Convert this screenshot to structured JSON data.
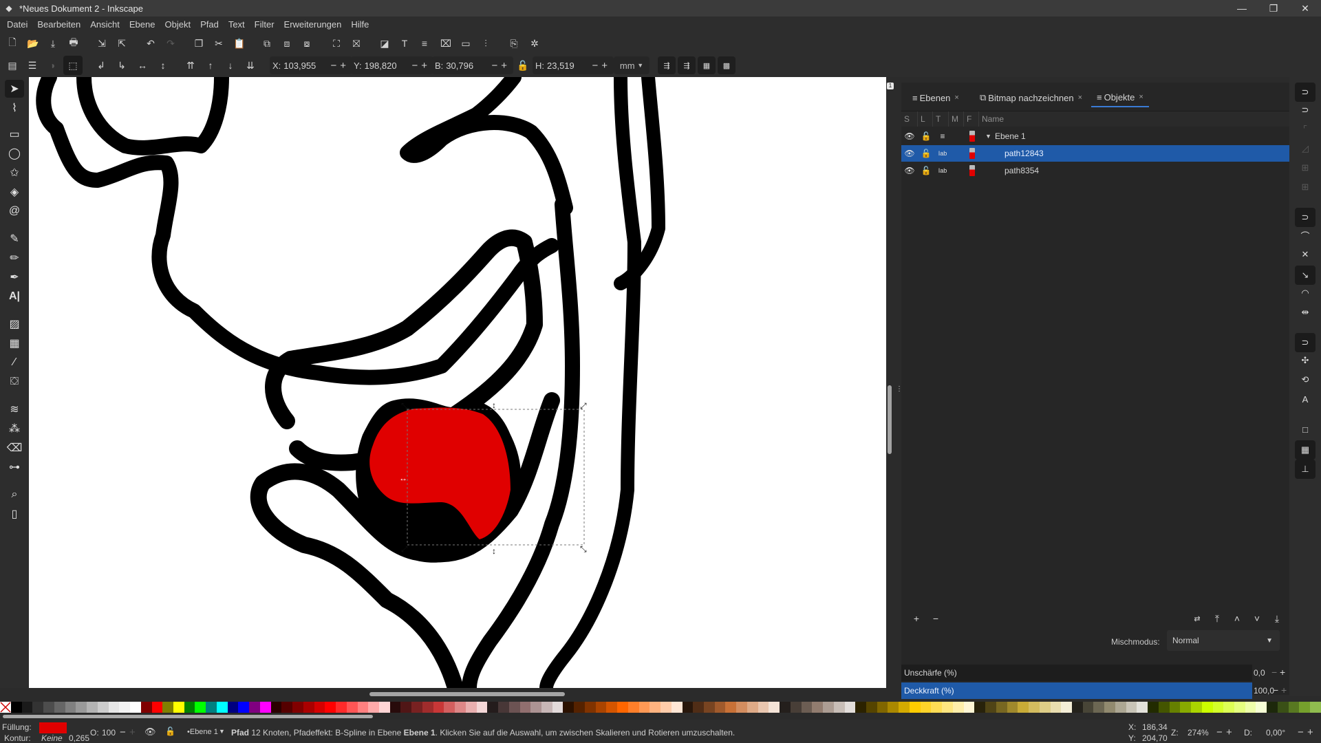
{
  "window": {
    "title": "*Neues Dokument 2 - Inkscape",
    "controls": [
      "minimize",
      "restore",
      "close"
    ]
  },
  "menu": [
    "Datei",
    "Bearbeiten",
    "Ansicht",
    "Ebene",
    "Objekt",
    "Pfad",
    "Text",
    "Filter",
    "Erweiterungen",
    "Hilfe"
  ],
  "commands": [
    {
      "name": "new-document",
      "glyph": "🗋"
    },
    {
      "name": "open",
      "glyph": "📂"
    },
    {
      "name": "save",
      "glyph": "⤓"
    },
    {
      "name": "print",
      "glyph": "🖶"
    },
    {
      "name": "import",
      "glyph": "⇲"
    },
    {
      "name": "export",
      "glyph": "⇱"
    },
    {
      "name": "undo",
      "glyph": "↶"
    },
    {
      "name": "redo",
      "glyph": "↷"
    },
    {
      "name": "copy",
      "glyph": "❐"
    },
    {
      "name": "cut",
      "glyph": "✂"
    },
    {
      "name": "paste",
      "glyph": "📋"
    },
    {
      "name": "duplicate",
      "glyph": "⧉"
    },
    {
      "name": "clone",
      "glyph": "⧈"
    },
    {
      "name": "unlink-clone",
      "glyph": "⧇"
    },
    {
      "name": "group",
      "glyph": "⛶"
    },
    {
      "name": "ungroup",
      "glyph": "⛝"
    },
    {
      "name": "fill-stroke",
      "glyph": "◪"
    },
    {
      "name": "text-font",
      "glyph": "T"
    },
    {
      "name": "layers",
      "glyph": "≡"
    },
    {
      "name": "xml-editor",
      "glyph": "⌧"
    },
    {
      "name": "document-properties",
      "glyph": "▭"
    },
    {
      "name": "align-distribute",
      "glyph": "⫶"
    },
    {
      "name": "zoom-page",
      "glyph": "⎘"
    },
    {
      "name": "preferences",
      "glyph": "✲"
    }
  ],
  "select_toolbar": {
    "x_label": "X:",
    "x_value": "103,955",
    "y_label": "Y:",
    "y_value": "198,820",
    "w_label": "B:",
    "w_value": "30,796",
    "h_label": "H:",
    "h_value": "23,519",
    "unit": "mm",
    "plus_minus": "−+",
    "buttons": [
      "select-all",
      "select-all-layers",
      "deselect",
      "touch-select",
      "rotate-ccw",
      "rotate-cw",
      "flip-horizontal",
      "flip-vertical",
      "raise-to-top",
      "raise",
      "lower",
      "lower-to-bottom"
    ]
  },
  "tools": [
    {
      "name": "selector",
      "glyph": "➤",
      "active": true
    },
    {
      "name": "node",
      "glyph": "⌇"
    },
    {
      "name": "rectangle",
      "glyph": "▭"
    },
    {
      "name": "ellipse",
      "glyph": "◯"
    },
    {
      "name": "star-polygon",
      "glyph": "✩"
    },
    {
      "name": "3d-box",
      "glyph": "◈"
    },
    {
      "name": "spiral",
      "glyph": "@"
    },
    {
      "name": "bezier",
      "glyph": "✎"
    },
    {
      "name": "pencil",
      "glyph": "✏"
    },
    {
      "name": "calligraphy",
      "glyph": "✒"
    },
    {
      "name": "text",
      "glyph": "A|"
    },
    {
      "name": "gradient",
      "glyph": "▨"
    },
    {
      "name": "mesh",
      "glyph": "▦"
    },
    {
      "name": "dropper",
      "glyph": "⁄"
    },
    {
      "name": "paint-bucket",
      "glyph": "⛋"
    },
    {
      "name": "tweak",
      "glyph": "≋"
    },
    {
      "name": "spray",
      "glyph": "⁂"
    },
    {
      "name": "eraser",
      "glyph": "⌫"
    },
    {
      "name": "connector",
      "glyph": "⊶"
    },
    {
      "name": "zoom",
      "glyph": "⌕"
    },
    {
      "name": "measure",
      "glyph": "▯"
    }
  ],
  "canvas": {
    "page_number": "1",
    "colors": {
      "stroke": "#000000",
      "fill": "#e00000",
      "background": "#ffffff"
    }
  },
  "dock": {
    "tabs": [
      {
        "label": "Ebenen",
        "glyph": "≡",
        "active": false
      },
      {
        "label": "Bitmap nachzeichnen",
        "glyph": "⧉",
        "active": false
      },
      {
        "label": "Objekte",
        "glyph": "≡",
        "active": true
      }
    ],
    "close_glyph": "×",
    "columns": [
      "S",
      "L",
      "T",
      "M",
      "F",
      "Name"
    ],
    "rows": [
      {
        "name": "Ebene 1",
        "type": "layer",
        "expanded": true,
        "selected": false
      },
      {
        "name": "path12843",
        "type": "path",
        "selected": true
      },
      {
        "name": "path8354",
        "type": "path",
        "selected": false
      }
    ],
    "footer_buttons": [
      "add",
      "remove",
      "move-to-layer",
      "raise-to-top",
      "raise",
      "lower",
      "lower-to-bottom"
    ],
    "blend_label": "Mischmodus:",
    "blend_value": "Normal",
    "blur_label": "Unschärfe (%)",
    "blur_value": "0,0",
    "opacity_label": "Deckkraft (%)",
    "opacity_value": "100,0",
    "accent": "#1f5aa8"
  },
  "snap_controls": [
    "snap-toggle",
    "snap-bbox",
    "snap-bbox-edges",
    "snap-bbox-corners",
    "snap-bbox-midpoints",
    "snap-bbox-centers",
    "snap-nodes",
    "snap-cusp",
    "snap-path",
    "snap-path-intersection",
    "snap-smooth",
    "snap-midpoints",
    "snap-others",
    "snap-centers",
    "snap-rotation-center",
    "snap-text-baseline",
    "snap-page",
    "snap-grid",
    "snap-guide"
  ],
  "palette": [
    "#000000",
    "#1a1a1a",
    "#333333",
    "#4d4d4d",
    "#666666",
    "#808080",
    "#999999",
    "#b3b3b3",
    "#cccccc",
    "#e6e6e6",
    "#f2f2f2",
    "#ffffff",
    "#800000",
    "#ff0000",
    "#808000",
    "#ffff00",
    "#008000",
    "#00ff00",
    "#008080",
    "#00ffff",
    "#000080",
    "#0000ff",
    "#800080",
    "#ff00ff",
    "#2b0000",
    "#550000",
    "#800000",
    "#aa0000",
    "#d40000",
    "#ff0000",
    "#ff2a2a",
    "#ff5555",
    "#ff8080",
    "#ffaaaa",
    "#ffd5d5",
    "#280b0b",
    "#501616",
    "#782121",
    "#a02c2c",
    "#c83737",
    "#d35f5f",
    "#de8787",
    "#e9afaf",
    "#f4d7d7",
    "#241c1c",
    "#483737",
    "#6c5353",
    "#916f6f",
    "#ac9393",
    "#c8b7b7",
    "#e3dbdb",
    "#2b1100",
    "#552200",
    "#803300",
    "#aa4400",
    "#d45500",
    "#ff6600",
    "#ff7f2a",
    "#ff9955",
    "#ffb380",
    "#ffccaa",
    "#ffe6d5",
    "#28170b",
    "#502d16",
    "#784421",
    "#a05a2c",
    "#c87137",
    "#d38d5f",
    "#deaa87",
    "#e9c6af",
    "#f4e3d7",
    "#241f1c",
    "#483e37",
    "#6c5d53",
    "#917c6f",
    "#ac9d93",
    "#c8beb7",
    "#e3dedb",
    "#2b2200",
    "#554400",
    "#806600",
    "#aa8800",
    "#d4aa00",
    "#ffcc00",
    "#ffd42a",
    "#ffdd55",
    "#ffe680",
    "#ffeeaa",
    "#fff6d5",
    "#28220b",
    "#504416",
    "#786721",
    "#a0892c",
    "#c8ab37",
    "#d3bc5f",
    "#decd87",
    "#e9ddaf",
    "#f4eed7",
    "#24221c",
    "#484537",
    "#6c6753",
    "#918a6f",
    "#aca793",
    "#c8c4b7",
    "#e3e2db",
    "#222b00",
    "#445500",
    "#668000",
    "#88aa00",
    "#aad400",
    "#ccff00",
    "#d4ff2a",
    "#ddff55",
    "#e5ff80",
    "#eeffaa",
    "#f6ffd5",
    "#1d280b",
    "#3a5016",
    "#587821",
    "#75a02c",
    "#8fbc4f"
  ],
  "status": {
    "fill_label": "Füllung:",
    "stroke_label": "Kontur:",
    "stroke_value": "Keine",
    "stroke_width": "0,265",
    "fill_color": "#e00000",
    "opacity_label": "O:",
    "opacity_value": "100",
    "layer": "•Ebene 1",
    "message_bold": "Pfad",
    "message_1": " 12 Knoten, Pfadeffekt: B-Spline in Ebene ",
    "message_layer": "Ebene 1",
    "message_2": ". Klicken Sie auf die Auswahl, um zwischen Skalieren und Rotieren umzuschalten.",
    "cursor_x_label": "X:",
    "cursor_x": "186,34",
    "cursor_y_label": "Y:",
    "cursor_y": "204,70",
    "zoom_label": "Z:",
    "zoom_value": "274%",
    "rotation_label": "D:",
    "rotation_value": "0,00°"
  }
}
